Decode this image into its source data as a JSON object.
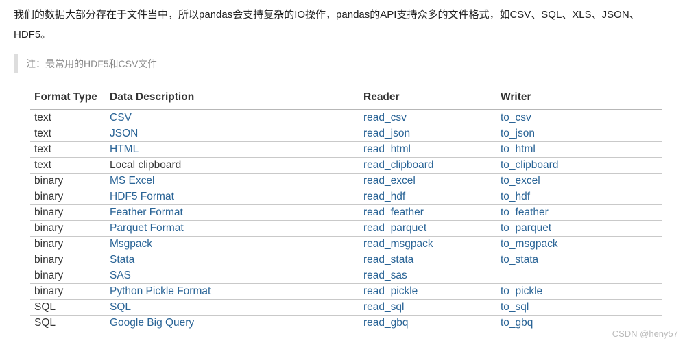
{
  "intro": "我们的数据大部分存在于文件当中，所以pandas会支持复杂的IO操作，pandas的API支持众多的文件格式，如CSV、SQL、XLS、JSON、HDF5。",
  "note": "注：最常用的HDF5和CSV文件",
  "table": {
    "headers": {
      "format": "Format Type",
      "desc": "Data Description",
      "reader": "Reader",
      "writer": "Writer"
    },
    "rows": [
      {
        "format": "text",
        "desc": "CSV",
        "desc_link": true,
        "reader": "read_csv",
        "writer": "to_csv"
      },
      {
        "format": "text",
        "desc": "JSON",
        "desc_link": true,
        "reader": "read_json",
        "writer": "to_json"
      },
      {
        "format": "text",
        "desc": "HTML",
        "desc_link": true,
        "reader": "read_html",
        "writer": "to_html"
      },
      {
        "format": "text",
        "desc": "Local clipboard",
        "desc_link": false,
        "reader": "read_clipboard",
        "writer": "to_clipboard"
      },
      {
        "format": "binary",
        "desc": "MS Excel",
        "desc_link": true,
        "reader": "read_excel",
        "writer": "to_excel"
      },
      {
        "format": "binary",
        "desc": "HDF5 Format",
        "desc_link": true,
        "reader": "read_hdf",
        "writer": "to_hdf"
      },
      {
        "format": "binary",
        "desc": "Feather Format",
        "desc_link": true,
        "reader": "read_feather",
        "writer": "to_feather"
      },
      {
        "format": "binary",
        "desc": "Parquet Format",
        "desc_link": true,
        "reader": "read_parquet",
        "writer": "to_parquet"
      },
      {
        "format": "binary",
        "desc": "Msgpack",
        "desc_link": true,
        "reader": "read_msgpack",
        "writer": "to_msgpack"
      },
      {
        "format": "binary",
        "desc": "Stata",
        "desc_link": true,
        "reader": "read_stata",
        "writer": "to_stata"
      },
      {
        "format": "binary",
        "desc": "SAS",
        "desc_link": true,
        "reader": "read_sas",
        "writer": ""
      },
      {
        "format": "binary",
        "desc": "Python Pickle Format",
        "desc_link": true,
        "reader": "read_pickle",
        "writer": "to_pickle"
      },
      {
        "format": "SQL",
        "desc": "SQL",
        "desc_link": true,
        "reader": "read_sql",
        "writer": "to_sql"
      },
      {
        "format": "SQL",
        "desc": "Google Big Query",
        "desc_link": true,
        "reader": "read_gbq",
        "writer": "to_gbq"
      }
    ]
  },
  "watermark": "CSDN @heny57"
}
